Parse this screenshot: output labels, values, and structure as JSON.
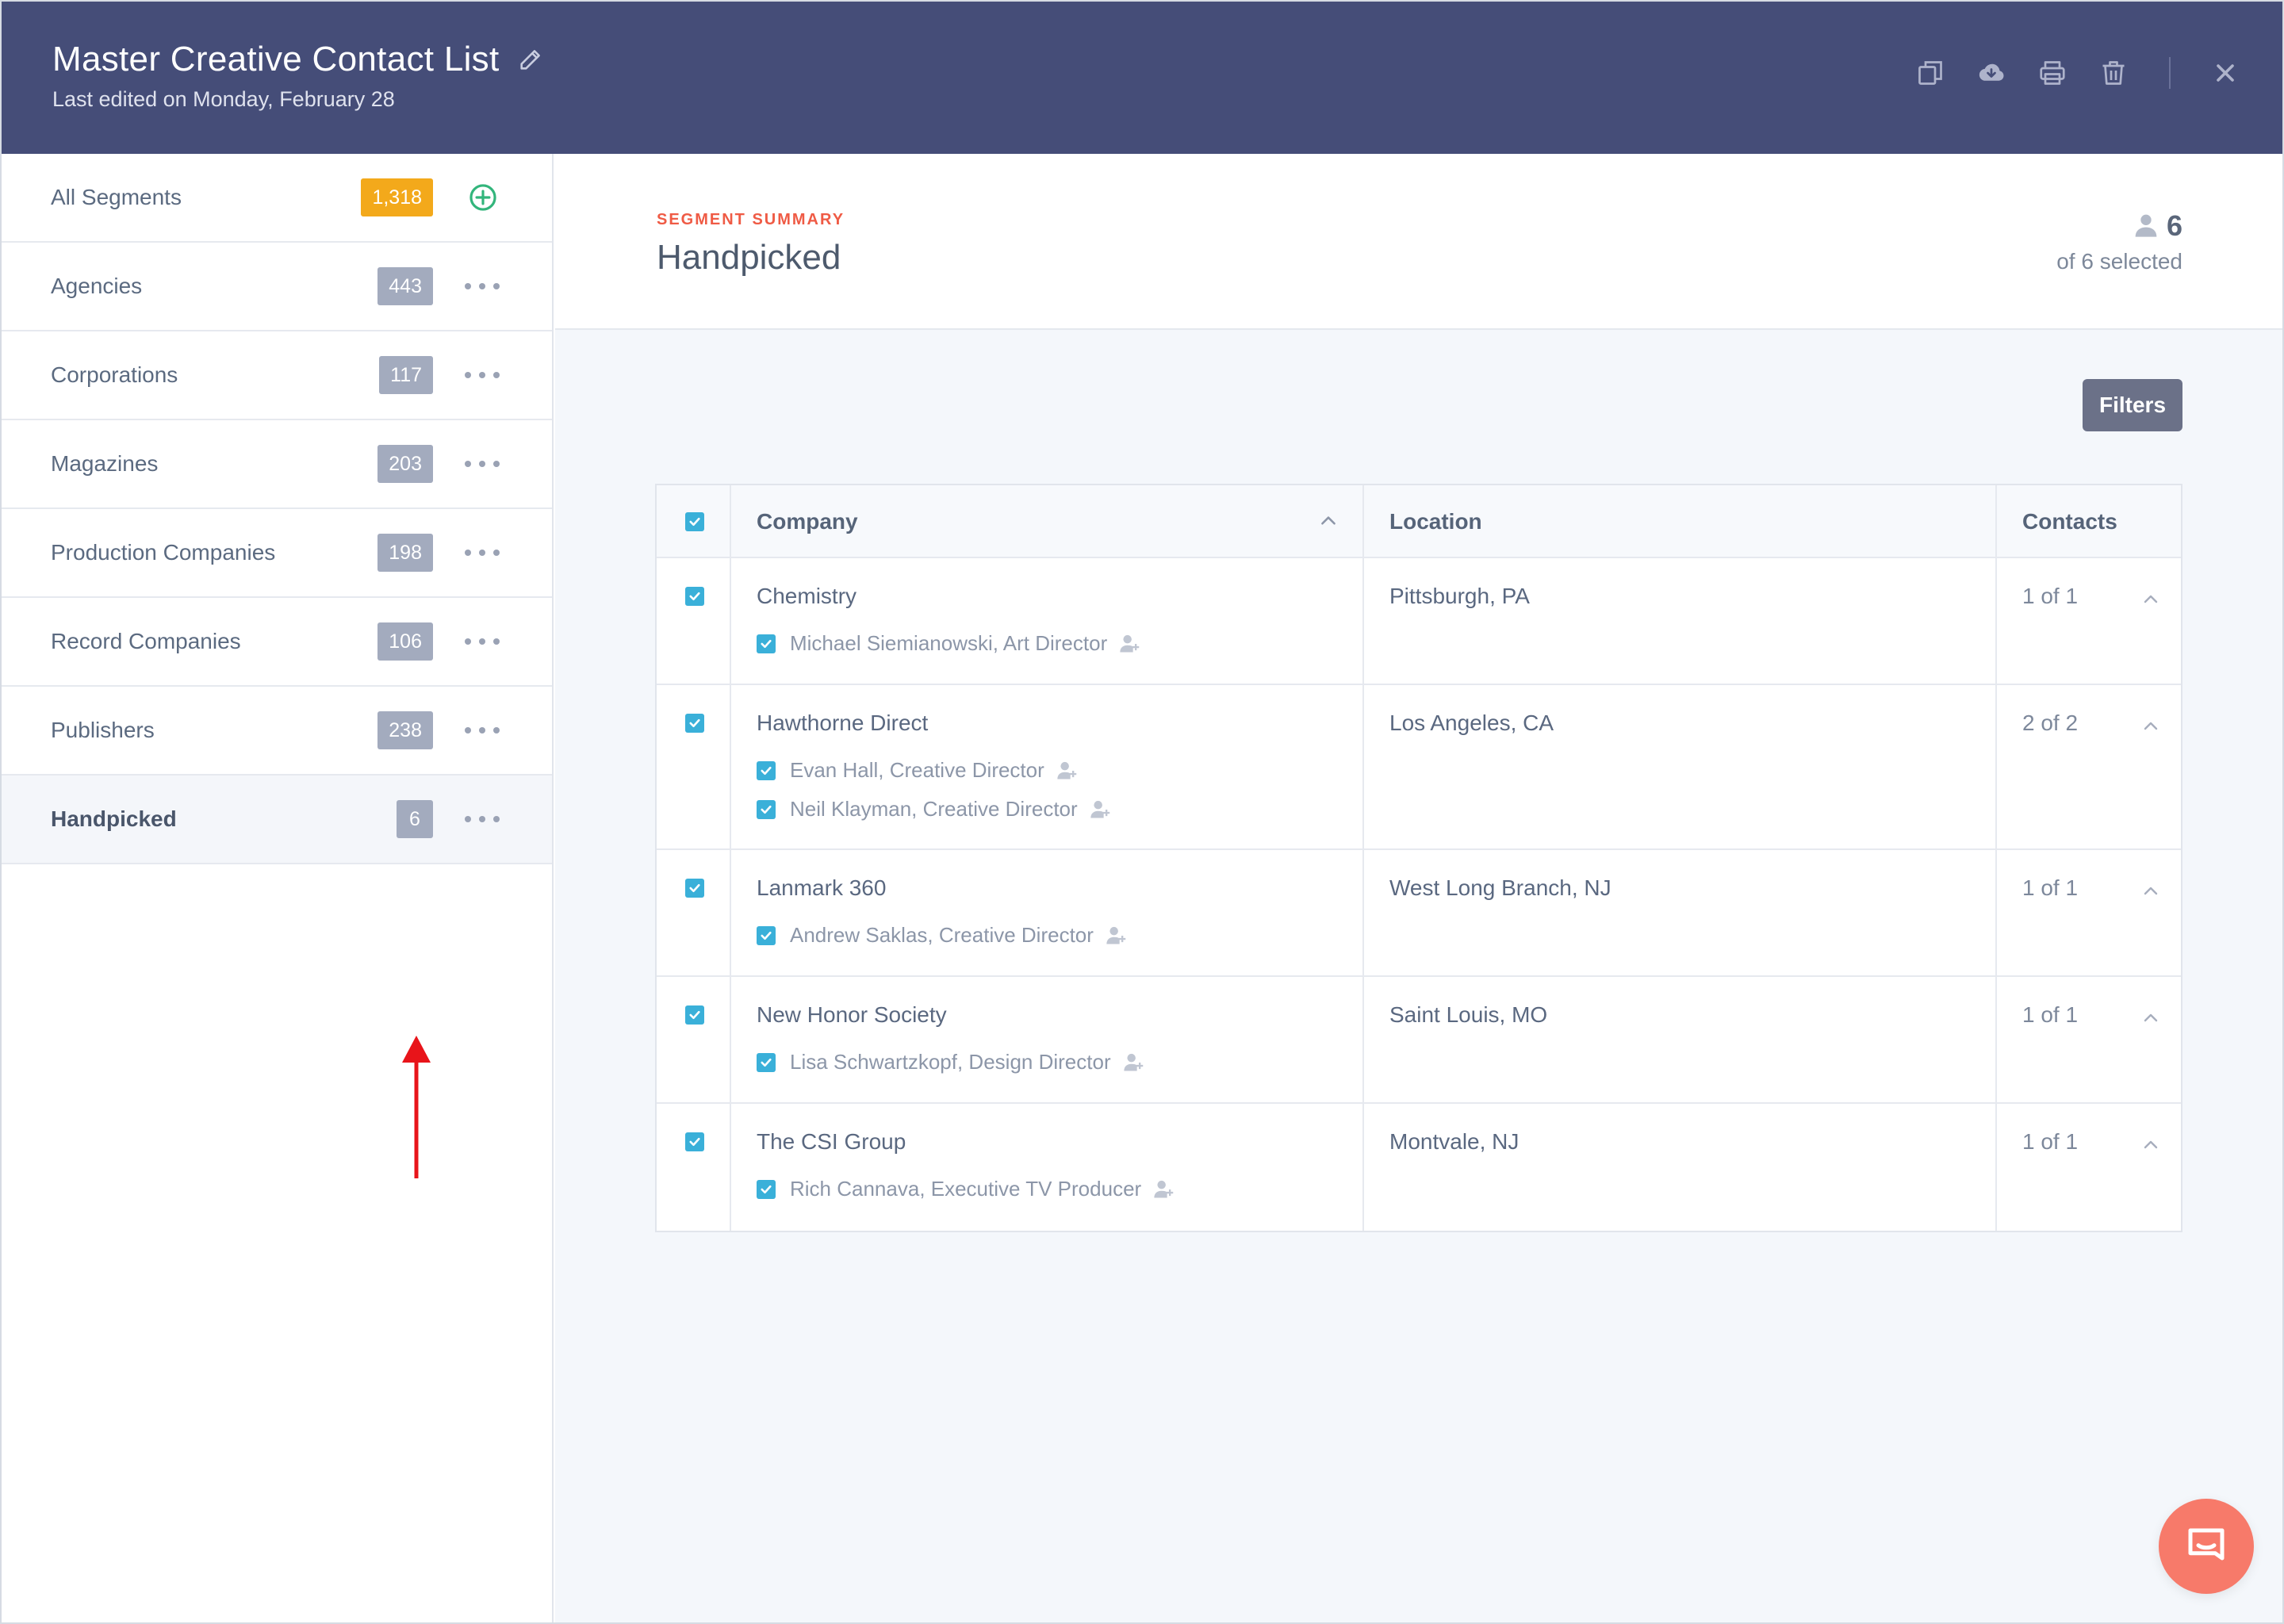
{
  "header": {
    "title": "Master Creative Contact List",
    "subtitle": "Last edited on Monday, February 28"
  },
  "sidebar": {
    "items": [
      {
        "label": "All Segments",
        "count": "1,318",
        "action": "add"
      },
      {
        "label": "Agencies",
        "count": "443",
        "action": "more"
      },
      {
        "label": "Corporations",
        "count": "117",
        "action": "more"
      },
      {
        "label": "Magazines",
        "count": "203",
        "action": "more"
      },
      {
        "label": "Production Companies",
        "count": "198",
        "action": "more"
      },
      {
        "label": "Record Companies",
        "count": "106",
        "action": "more"
      },
      {
        "label": "Publishers",
        "count": "238",
        "action": "more"
      },
      {
        "label": "Handpicked",
        "count": "6",
        "action": "more",
        "active": true
      }
    ]
  },
  "summary": {
    "eyebrow": "SEGMENT SUMMARY",
    "title": "Handpicked",
    "count": "6",
    "of_selected": "of 6 selected"
  },
  "filters_label": "Filters",
  "table": {
    "headers": {
      "company": "Company",
      "location": "Location",
      "contacts": "Contacts"
    },
    "rows": [
      {
        "company": "Chemistry",
        "location": "Pittsburgh, PA",
        "contacts_count": "1 of 1",
        "contacts": [
          "Michael Siemianowski, Art Director"
        ]
      },
      {
        "company": "Hawthorne Direct",
        "location": "Los Angeles, CA",
        "contacts_count": "2 of 2",
        "contacts": [
          "Evan Hall, Creative Director",
          "Neil Klayman, Creative Director"
        ]
      },
      {
        "company": "Lanmark 360",
        "location": "West Long Branch, NJ",
        "contacts_count": "1 of 1",
        "contacts": [
          "Andrew Saklas, Creative Director"
        ]
      },
      {
        "company": "New Honor Society",
        "location": "Saint Louis, MO",
        "contacts_count": "1 of 1",
        "contacts": [
          "Lisa Schwartzkopf, Design Director"
        ]
      },
      {
        "company": "The CSI Group",
        "location": "Montvale, NJ",
        "contacts_count": "1 of 1",
        "contacts": [
          "Rich Cannava, Executive TV Producer"
        ]
      }
    ]
  },
  "colors": {
    "header_bg": "#454d78",
    "accent_gold": "#f3a91b",
    "checkbox": "#3ab0d9",
    "eyebrow": "#ef5b45",
    "chat": "#f77a6a",
    "add_green": "#32b57b",
    "annotation_arrow": "#e8141a"
  },
  "icons": {
    "header_actions": [
      "copy-icon",
      "cloud-download-icon",
      "print-icon",
      "trash-icon",
      "close-icon"
    ]
  }
}
